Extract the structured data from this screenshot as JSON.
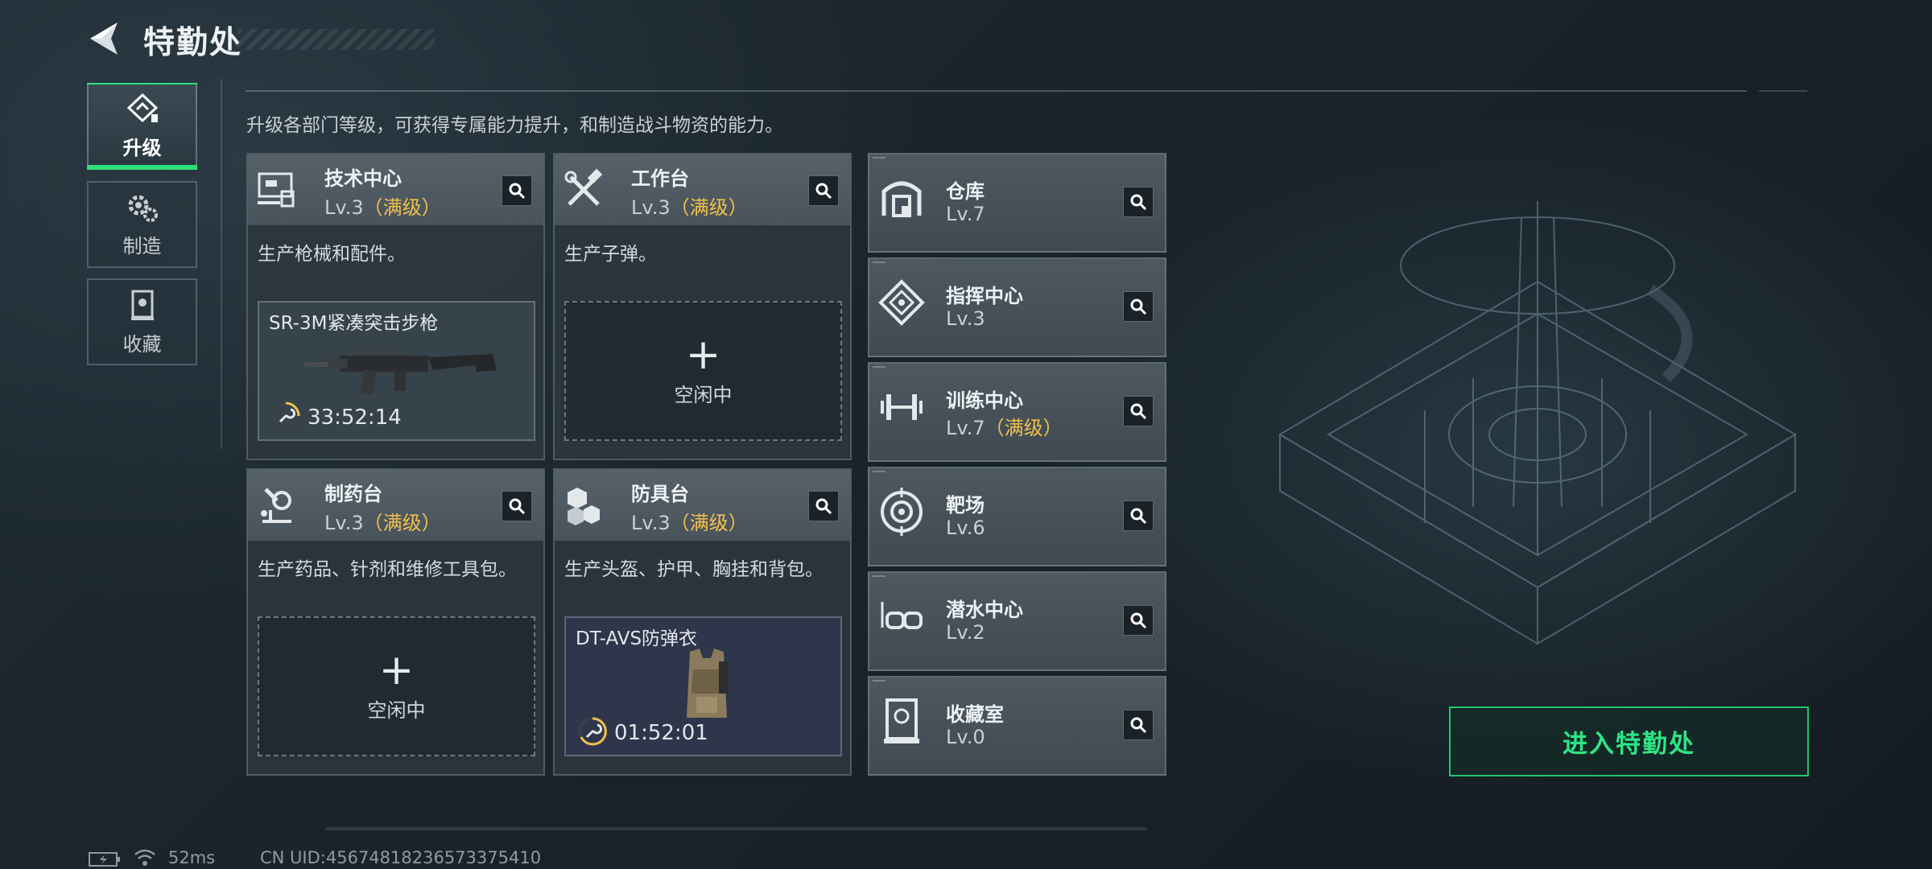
{
  "header": {
    "title": "特勤处"
  },
  "nav": [
    {
      "label": "升级",
      "icon": "upgrade-icon",
      "active": true
    },
    {
      "label": "制造",
      "icon": "gears-icon",
      "active": false
    },
    {
      "label": "收藏",
      "icon": "trophy-case-icon",
      "active": false
    }
  ],
  "subtitle": "升级各部门等级，可获得专属能力提升，和制造战斗物资的能力。",
  "cards": [
    {
      "name": "技术中心",
      "level": "Lv.3",
      "max": "（满级）",
      "desc": "生产枪械和配件。",
      "icon": "computer-icon",
      "slot": {
        "state": "producing",
        "item": "SR-3M紧凑突击步枪",
        "timer": "33:52:14"
      }
    },
    {
      "name": "工作台",
      "level": "Lv.3",
      "max": "（满级）",
      "desc": "生产子弹。",
      "icon": "tools-icon",
      "slot": {
        "state": "idle",
        "text": "空闲中"
      }
    },
    {
      "name": "制药台",
      "level": "Lv.3",
      "max": "（满级）",
      "desc": "生产药品、针剂和维修工具包。",
      "icon": "microscope-icon",
      "slot": {
        "state": "idle",
        "text": "空闲中"
      }
    },
    {
      "name": "防具台",
      "level": "Lv.3",
      "max": "（满级）",
      "desc": "生产头盔、护甲、胸挂和背包。",
      "icon": "armor-blocks-icon",
      "slot": {
        "state": "producing",
        "item": "DT-AVS防弹衣",
        "timer": "01:52:01"
      }
    }
  ],
  "rows": [
    {
      "name": "仓库",
      "level": "Lv.7",
      "max": "",
      "icon": "warehouse-icon"
    },
    {
      "name": "指挥中心",
      "level": "Lv.3",
      "max": "",
      "icon": "command-icon"
    },
    {
      "name": "训练中心",
      "level": "Lv.7",
      "max": "（满级）",
      "icon": "dumbbell-icon"
    },
    {
      "name": "靶场",
      "level": "Lv.6",
      "max": "",
      "icon": "target-icon"
    },
    {
      "name": "潜水中心",
      "level": "Lv.2",
      "max": "",
      "icon": "diving-mask-icon"
    },
    {
      "name": "收藏室",
      "level": "Lv.0",
      "max": "",
      "icon": "display-case-icon"
    }
  ],
  "enter_button": "进入特勤处",
  "status": {
    "ping": "52ms",
    "uid": "CN UID:45674818236573375410"
  },
  "colors": {
    "accent_green": "#2de584",
    "max_level": "#f2c04a"
  }
}
